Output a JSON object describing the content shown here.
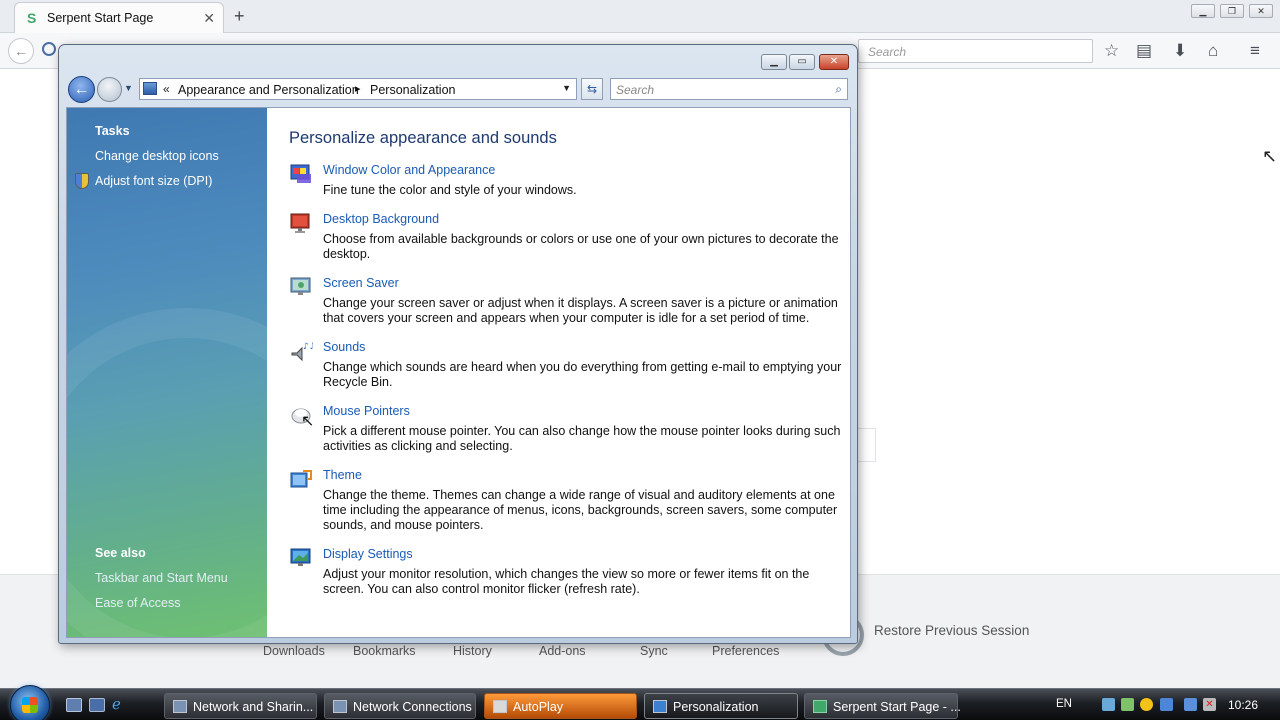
{
  "browser": {
    "tab_title": "Serpent Start Page",
    "tab_close": "✕",
    "new_tab": "+",
    "search_placeholder": "Search",
    "window_controls": [
      "▁",
      "❐",
      "✕"
    ]
  },
  "start_page": {
    "launchers": [
      "Downloads",
      "Bookmarks",
      "History",
      "Add-ons",
      "Sync",
      "Preferences"
    ],
    "restore_session": "Restore Previous Session"
  },
  "control_panel": {
    "breadcrumb": [
      "Appearance and Personalization",
      "Personalization"
    ],
    "crumb_prefix": "«",
    "crumb_separator": "▸",
    "search_placeholder": "Search",
    "sidebar": {
      "tasks_heading": "Tasks",
      "tasks": [
        "Change desktop icons",
        "Adjust font size (DPI)"
      ],
      "see_also_heading": "See also",
      "see_also": [
        "Taskbar and Start Menu",
        "Ease of Access"
      ]
    },
    "title": "Personalize appearance and sounds",
    "items": [
      {
        "link": "Window Color and Appearance",
        "desc": "Fine tune the color and style of your windows.",
        "icon": "window-color-icon"
      },
      {
        "link": "Desktop Background",
        "desc": "Choose from available backgrounds or colors or use one of your own pictures to decorate the desktop.",
        "icon": "desktop-background-icon"
      },
      {
        "link": "Screen Saver",
        "desc": "Change your screen saver or adjust when it displays. A screen saver is a picture or animation that covers your screen and appears when your computer is idle for a set period of time.",
        "icon": "screen-saver-icon"
      },
      {
        "link": "Sounds",
        "desc": "Change which sounds are heard when you do everything from getting e-mail to emptying your Recycle Bin.",
        "icon": "sounds-icon"
      },
      {
        "link": "Mouse Pointers",
        "desc": "Pick a different mouse pointer. You can also change how the mouse pointer looks during such activities as clicking and selecting.",
        "icon": "mouse-pointers-icon"
      },
      {
        "link": "Theme",
        "desc": "Change the theme. Themes can change a wide range of visual and auditory elements at one time including the appearance of menus, icons, backgrounds, screen savers, some computer sounds, and mouse pointers.",
        "icon": "theme-icon"
      },
      {
        "link": "Display Settings",
        "desc": "Adjust your monitor resolution, which changes the view so more or fewer items fit on the screen. You can also control monitor flicker (refresh rate).",
        "icon": "display-settings-icon"
      }
    ]
  },
  "taskbar": {
    "buttons": [
      "Network and Sharin...",
      "Network Connections",
      "AutoPlay",
      "Personalization",
      "Serpent Start Page - ..."
    ],
    "language": "EN",
    "clock": "10:26"
  }
}
